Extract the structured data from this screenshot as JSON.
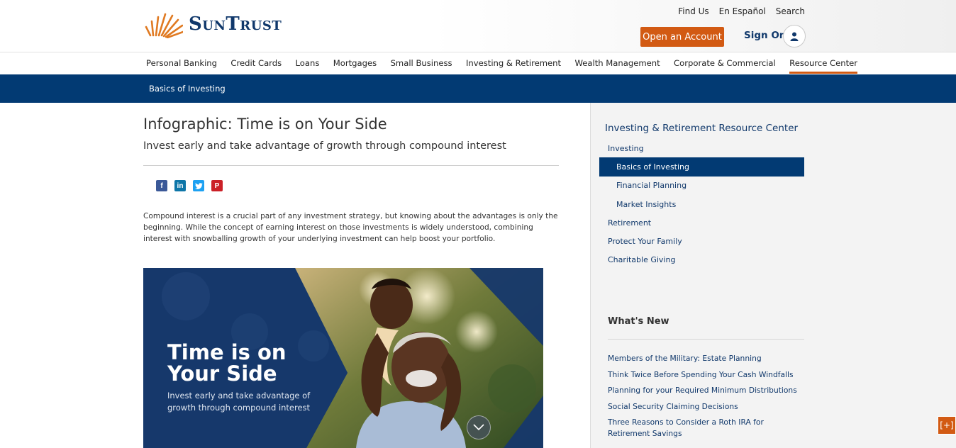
{
  "header": {
    "logo_text": "SunTrust",
    "util_links": [
      "Find Us",
      "En Español",
      "Search"
    ],
    "open_account": "Open an Account",
    "sign_on": "Sign On"
  },
  "nav": {
    "items": [
      "Personal Banking",
      "Credit Cards",
      "Loans",
      "Mortgages",
      "Small Business",
      "Investing & Retirement",
      "Wealth Management",
      "Corporate & Commercial",
      "Resource Center"
    ],
    "active": "Resource Center"
  },
  "subnav": {
    "label": "Basics of Investing"
  },
  "article": {
    "title": "Infographic: Time is on Your Side",
    "subtitle": "Invest early and take advantage of growth through compound interest",
    "social": [
      "facebook-icon",
      "linkedin-icon",
      "twitter-icon",
      "pinterest-icon"
    ],
    "body": "Compound interest is a crucial part of any investment strategy, but knowing about the advantages is only the beginning. While the concept of earning interest on those investments is widely understood, combining interest with snowballing growth of your underlying investment can help boost your portfolio.",
    "hero": {
      "heading_line1": "Time is on",
      "heading_line2": "Your Side",
      "sub_line1": "Invest early and take advantage of",
      "sub_line2": "growth through compound interest"
    }
  },
  "sidebar": {
    "title": "Investing & Retirement Resource Center",
    "nav": [
      {
        "label": "Investing",
        "level": 1,
        "active": false
      },
      {
        "label": "Basics of Investing",
        "level": 2,
        "active": true
      },
      {
        "label": "Financial Planning",
        "level": 2,
        "active": false
      },
      {
        "label": "Market Insights",
        "level": 2,
        "active": false
      },
      {
        "label": "Retirement",
        "level": 1,
        "active": false
      },
      {
        "label": "Protect Your Family",
        "level": 1,
        "active": false
      },
      {
        "label": "Charitable Giving",
        "level": 1,
        "active": false
      }
    ],
    "whats_new_title": "What's New",
    "whats_new": [
      "Members of the Military: Estate Planning",
      "Think Twice Before Spending Your Cash Windfalls",
      "Planning for your Required Minimum Distributions",
      "Social Security Claiming Decisions",
      "Three Reasons to Consider a Roth IRA for Retirement Savings"
    ]
  },
  "feedback": {
    "label": "[+]"
  },
  "colors": {
    "brand_navy": "#023a73",
    "accent_orange": "#d25a13",
    "link_blue": "#10386b"
  }
}
